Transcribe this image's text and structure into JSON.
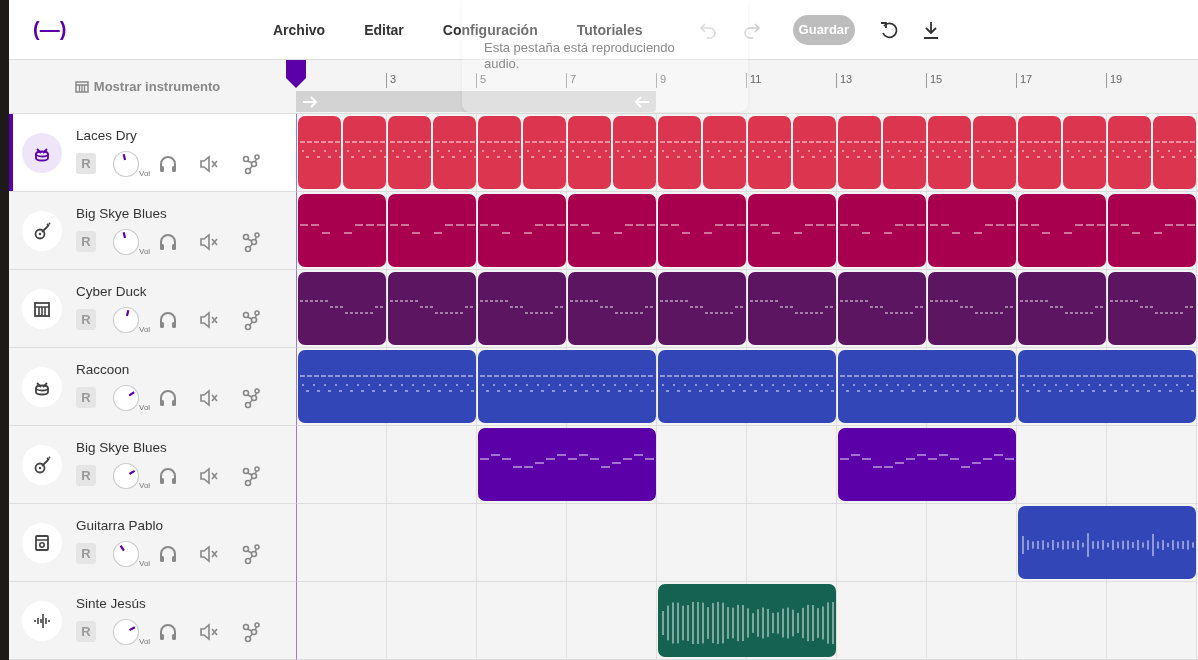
{
  "header": {
    "logo": "(—)",
    "menu": [
      "Archivo",
      "Editar",
      "Configuración",
      "Tutoriales"
    ],
    "tools": [
      {
        "kind": "undo",
        "disabled": true
      },
      {
        "kind": "redo",
        "disabled": true
      }
    ],
    "save": {
      "label": "Guardar",
      "disabled": true
    },
    "actions": [
      {
        "kind": "reset"
      },
      {
        "kind": "download"
      }
    ]
  },
  "tooltip": {
    "text": "Esta pestaña está reproduciendo audio."
  },
  "ruler": {
    "show_instrument": "Mostrar instrumento",
    "bars": [
      "3",
      "5",
      "7",
      "9",
      "11",
      "13",
      "15",
      "17",
      "19"
    ]
  },
  "tracks": [
    {
      "name": "Laces Dry",
      "kind": "drums",
      "selected": true,
      "record": "R",
      "level": 0.45,
      "vol": "Vol",
      "lane": {
        "kind": "midi",
        "color": "#dc3550"
      }
    },
    {
      "name": "Big Skye Blues",
      "kind": "guitar",
      "selected": false,
      "record": "R",
      "level": 0.45,
      "vol": "Vol",
      "lane": {
        "kind": "midi",
        "color": "#a8004f"
      }
    },
    {
      "name": "Cyber Duck",
      "kind": "keys",
      "selected": false,
      "record": "R",
      "level": 0.55,
      "vol": "Vol",
      "lane": {
        "kind": "midi",
        "color": "#5c1560"
      }
    },
    {
      "name": "Raccoon",
      "kind": "drums",
      "selected": false,
      "record": "R",
      "level": 0.7,
      "vol": "Vol",
      "lane": {
        "kind": "midi",
        "color": "#3346b8"
      }
    },
    {
      "name": "Big Skye Blues",
      "kind": "guitar",
      "selected": false,
      "record": "R",
      "level": 0.72,
      "vol": "Vol",
      "lane": {
        "kind": "midi",
        "color": "#5b00a8"
      }
    },
    {
      "name": "Guitarra Pablo",
      "kind": "amp",
      "selected": false,
      "record": "R",
      "level": 0.38,
      "vol": "Vol",
      "lane": {
        "kind": "audio",
        "color": "#3346b8"
      }
    },
    {
      "name": "Sinte Jesús",
      "kind": "synth",
      "selected": false,
      "record": "R",
      "level": 0.73,
      "vol": "Vol",
      "lane": {
        "kind": "audio",
        "color": "#14624f"
      }
    }
  ]
}
